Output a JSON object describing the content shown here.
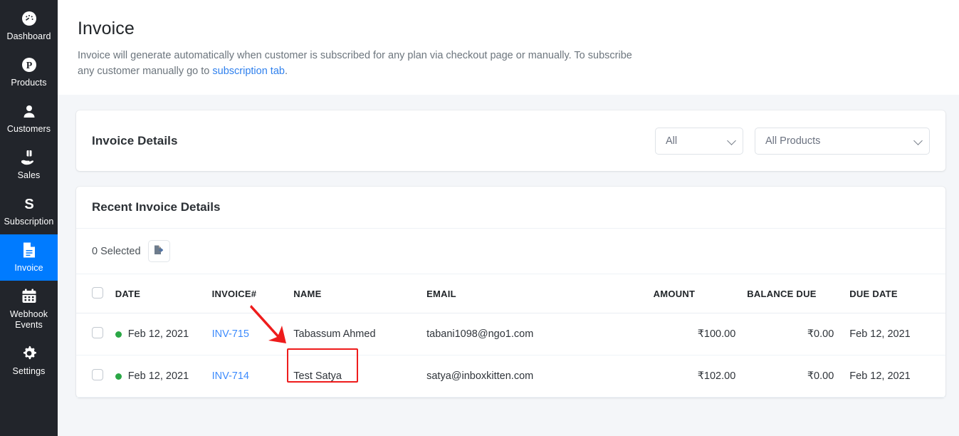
{
  "sidebar": {
    "items": [
      {
        "label": "Dashboard",
        "icon": "dashboard-icon",
        "active": false
      },
      {
        "label": "Products",
        "icon": "product-tag-icon",
        "active": false
      },
      {
        "label": "Customers",
        "icon": "user-icon",
        "active": false
      },
      {
        "label": "Sales",
        "icon": "hand-money-icon",
        "active": false
      },
      {
        "label": "Subscription",
        "icon": "stripe-s-icon",
        "active": false
      },
      {
        "label": "Invoice",
        "icon": "document-icon",
        "active": true
      },
      {
        "label": "Webhook\nEvents",
        "icon": "calendar-icon",
        "active": false
      },
      {
        "label": "Settings",
        "icon": "gear-icon",
        "active": false
      }
    ]
  },
  "header": {
    "title": "Invoice",
    "description_before": "Invoice will generate automatically when customer is subscribed for any plan via checkout page or manually. To subscribe any customer manually go to ",
    "link_text": "subscription tab",
    "description_after": "."
  },
  "filter_card": {
    "title": "Invoice Details",
    "status_select": {
      "value": "All"
    },
    "product_select": {
      "value": "All Products"
    }
  },
  "recent": {
    "title": "Recent Invoice Details",
    "toolbar": {
      "selected_label": "0 Selected",
      "export_icon": "export-file-icon"
    },
    "columns": {
      "date": "DATE",
      "invoice": "INVOICE#",
      "name": "NAME",
      "email": "EMAIL",
      "amount": "AMOUNT",
      "balance_due": "BALANCE DUE",
      "due_date": "DUE DATE"
    },
    "rows": [
      {
        "status": "active",
        "date": "Feb 12, 2021",
        "invoice": "INV-715",
        "name": "Tabassum Ahmed",
        "email": "tabani1098@ngo1.com",
        "amount": "₹100.00",
        "balance_due": "₹0.00",
        "due_date": "Feb 12, 2021"
      },
      {
        "status": "active",
        "date": "Feb 12, 2021",
        "invoice": "INV-714",
        "name": "Test Satya",
        "email": "satya@inboxkitten.com",
        "amount": "₹102.00",
        "balance_due": "₹0.00",
        "due_date": "Feb 12, 2021"
      }
    ]
  },
  "colors": {
    "sidebar_bg": "#22252b",
    "accent_blue": "#007bff",
    "link_blue": "#3d8bfd",
    "status_green": "#2aa745",
    "annotation_red": "#ee1c1c",
    "page_bg": "#f4f6f9"
  }
}
